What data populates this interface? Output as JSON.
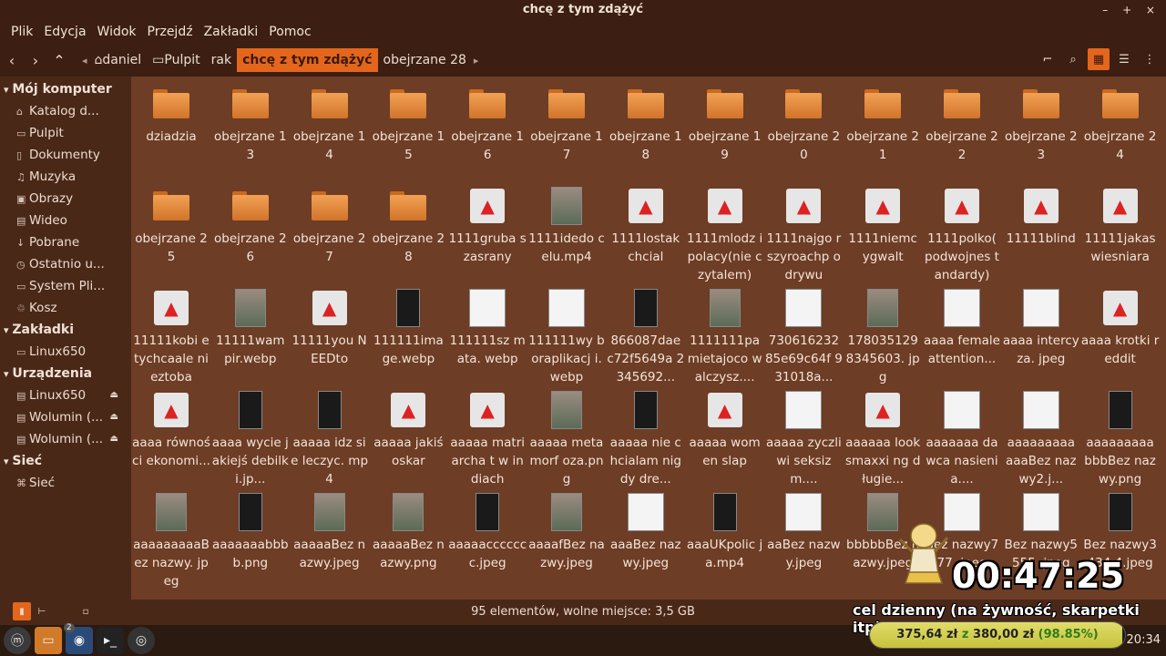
{
  "window": {
    "title": "chcę z tym zdążyć",
    "controls": "– + ×"
  },
  "menu": [
    "Plik",
    "Edycja",
    "Widok",
    "Przejdź",
    "Zakładki",
    "Pomoc"
  ],
  "breadcrumbs": [
    {
      "label": "daniel",
      "icon": "home-icon"
    },
    {
      "label": "Pulpit",
      "icon": "folder-icon"
    },
    {
      "label": "rak"
    },
    {
      "label": "chcę z tym zdążyć",
      "active": true
    },
    {
      "label": "obejrzane 28"
    }
  ],
  "sidebar": {
    "sections": [
      {
        "title": "Mój komputer",
        "items": [
          {
            "label": "Katalog d...",
            "icon": "home-icon"
          },
          {
            "label": "Pulpit",
            "icon": "desktop-icon"
          },
          {
            "label": "Dokumenty",
            "icon": "document-icon"
          },
          {
            "label": "Muzyka",
            "icon": "music-icon"
          },
          {
            "label": "Obrazy",
            "icon": "image-icon"
          },
          {
            "label": "Wideo",
            "icon": "video-icon"
          },
          {
            "label": "Pobrane",
            "icon": "download-icon"
          },
          {
            "label": "Ostatnio u...",
            "icon": "recent-icon"
          },
          {
            "label": "System Pli...",
            "icon": "drive-icon"
          },
          {
            "label": "Kosz",
            "icon": "trash-icon"
          }
        ]
      },
      {
        "title": "Zakładki",
        "items": [
          {
            "label": "Linux650",
            "icon": "folder-icon"
          }
        ]
      },
      {
        "title": "Urządzenia",
        "items": [
          {
            "label": "Linux650",
            "icon": "drive-icon",
            "eject": true
          },
          {
            "label": "Wolumin (...",
            "icon": "drive-icon",
            "eject": true
          },
          {
            "label": "Wolumin (...",
            "icon": "drive-icon",
            "eject": true
          }
        ]
      },
      {
        "title": "Sieć",
        "items": [
          {
            "label": "Sieć",
            "icon": "network-icon"
          }
        ]
      }
    ]
  },
  "files": [
    {
      "name": "dziadzia",
      "kind": "folder"
    },
    {
      "name": "obejrzane 13",
      "kind": "folder"
    },
    {
      "name": "obejrzane 14",
      "kind": "folder"
    },
    {
      "name": "obejrzane 15",
      "kind": "folder"
    },
    {
      "name": "obejrzane 16",
      "kind": "folder"
    },
    {
      "name": "obejrzane 17",
      "kind": "folder"
    },
    {
      "name": "obejrzane 18",
      "kind": "folder"
    },
    {
      "name": "obejrzane 19",
      "kind": "folder"
    },
    {
      "name": "obejrzane 20",
      "kind": "folder"
    },
    {
      "name": "obejrzane 21",
      "kind": "folder"
    },
    {
      "name": "obejrzane 22",
      "kind": "folder"
    },
    {
      "name": "obejrzane 23",
      "kind": "folder"
    },
    {
      "name": "obejrzane 24",
      "kind": "folder"
    },
    {
      "name": "obejrzane 25",
      "kind": "folder"
    },
    {
      "name": "obejrzane 26",
      "kind": "folder"
    },
    {
      "name": "obejrzane 27",
      "kind": "folder"
    },
    {
      "name": "obejrzane 28",
      "kind": "folder"
    },
    {
      "name": "1111gruba szasrany",
      "kind": "video"
    },
    {
      "name": "1111idedo celu.mp4",
      "kind": "pic"
    },
    {
      "name": "1111lostak chcial",
      "kind": "video"
    },
    {
      "name": "1111mlodz ipolacy(nie czytalem)",
      "kind": "video"
    },
    {
      "name": "1111najgo rszyroachp odrywu",
      "kind": "video"
    },
    {
      "name": "1111niemc ygwalt",
      "kind": "video"
    },
    {
      "name": "1111polko( podwojnes tandardy)",
      "kind": "video"
    },
    {
      "name": "11111blind",
      "kind": "video"
    },
    {
      "name": "11111jakas wiesniara",
      "kind": "video"
    },
    {
      "name": "11111kobi etychcaale nieztoba",
      "kind": "video"
    },
    {
      "name": "11111wam pir.webp",
      "kind": "pic"
    },
    {
      "name": "11111you NEEDto",
      "kind": "video"
    },
    {
      "name": "111111ima ge.webp",
      "kind": "dark"
    },
    {
      "name": "111111sz mata. webp",
      "kind": "doc"
    },
    {
      "name": "111111wy boraplikacj i.webp",
      "kind": "doc"
    },
    {
      "name": "866087dae c72f5649a 2345692...",
      "kind": "dark"
    },
    {
      "name": "1111111pa mietajoco walczysz....",
      "kind": "pic"
    },
    {
      "name": "730616232 85e69c64f 931018a...",
      "kind": "doc"
    },
    {
      "name": "178035129 8345603. jpg",
      "kind": "pic"
    },
    {
      "name": "aaaa female attention...",
      "kind": "doc"
    },
    {
      "name": "aaaa intercyza. jpeg",
      "kind": "doc"
    },
    {
      "name": "aaaa krotki reddit",
      "kind": "video"
    },
    {
      "name": "aaaa równości ekonomi...",
      "kind": "video"
    },
    {
      "name": "aaaa wycie jakiejś debilki.jp...",
      "kind": "dark"
    },
    {
      "name": "aaaaa idz sie leczyc. mp4",
      "kind": "dark"
    },
    {
      "name": "aaaaa jakiś oskar",
      "kind": "video"
    },
    {
      "name": "aaaaa matriarcha t w indiach",
      "kind": "video"
    },
    {
      "name": "aaaaa metamorf oza.png",
      "kind": "pic"
    },
    {
      "name": "aaaaa nie chcialam nigdy dre...",
      "kind": "dark"
    },
    {
      "name": "aaaaa women slap",
      "kind": "video"
    },
    {
      "name": "aaaaa zyczliwi seksizm....",
      "kind": "doc"
    },
    {
      "name": "aaaaaa looksmaxxi ng długie...",
      "kind": "video"
    },
    {
      "name": "aaaaaaa dawca nasienia....",
      "kind": "doc"
    },
    {
      "name": "aaaaaaaaa aaaBez nazwy2.j...",
      "kind": "doc"
    },
    {
      "name": "aaaaaaaaa bbbBez nazwy.png",
      "kind": "dark"
    },
    {
      "name": "aaaaaaaaaB ez nazwy. jpeg",
      "kind": "pic"
    },
    {
      "name": "aaaaaaabbb b.png",
      "kind": "dark"
    },
    {
      "name": "aaaaaBez nazwy.jpeg",
      "kind": "pic"
    },
    {
      "name": "aaaaaBez nazwy.png",
      "kind": "pic"
    },
    {
      "name": "aaaaacccccc c.jpeg",
      "kind": "dark"
    },
    {
      "name": "aaaafBez nazwy.jpeg",
      "kind": "pic"
    },
    {
      "name": "aaaBez nazwy.jpeg",
      "kind": "doc"
    },
    {
      "name": "aaaUKpolic ja.mp4",
      "kind": "dark"
    },
    {
      "name": "aaBez nazwy.jpeg",
      "kind": "doc"
    },
    {
      "name": "bbbbbBez nazwy.jpeg",
      "kind": "pic"
    },
    {
      "name": "Bez nazwy777. jpeg",
      "kind": "doc"
    },
    {
      "name": "Bez nazwy5555 .jpeg",
      "kind": "doc"
    },
    {
      "name": "Bez nazwy3434 4.jpeg",
      "kind": "dark"
    }
  ],
  "status": {
    "text": "95 elementów, wolne miejsce: 3,5 GB"
  },
  "taskbar": {
    "clock": "20:34",
    "badge": "2"
  },
  "overlay": {
    "timer": "00:47:25",
    "goal_label": "cel dzienny (na żywność, skarpetki itp)",
    "amount_current": "375,64 zł",
    "amount_sep": "z",
    "amount_target": "380,00 zł",
    "percent_text": "(98.85%)",
    "progress_fraction": 0.9885
  }
}
